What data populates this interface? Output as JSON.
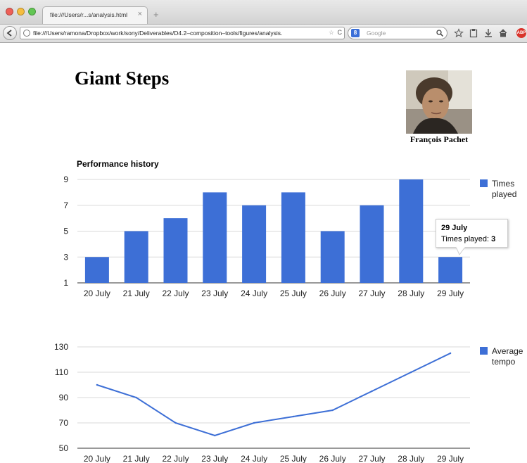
{
  "browser": {
    "tab_title": "file:///Users/r...s/analysis.html",
    "tab_close": "×",
    "new_tab": "+",
    "url": "file:///Users/ramona/Dropbox/work/sony/Deliverables/D4.2–composition–tools/figures/analysis.",
    "url_reload": "C",
    "url_star": "☆",
    "search_engine_letter": "8",
    "search_placeholder": "Google",
    "icons": [
      "search-icon",
      "bookmark-star-icon",
      "clipboard-icon",
      "download-icon",
      "home-icon",
      "adblock-icon"
    ]
  },
  "page": {
    "title": "Giant Steps",
    "author_name": "François Pachet"
  },
  "colors": {
    "series": "#3d6fd6",
    "grid": "#d9d9d9",
    "axis": "#333333"
  },
  "chart_data": [
    {
      "type": "bar",
      "title": "Performance history",
      "categories": [
        "20 July",
        "21 July",
        "22 July",
        "23 July",
        "24 July",
        "25 July",
        "26 July",
        "27 July",
        "28 July",
        "29 July"
      ],
      "series": [
        {
          "name": "Times played",
          "values": [
            3,
            5,
            6,
            8,
            7,
            8,
            5,
            7,
            9,
            3
          ]
        }
      ],
      "y_ticks": [
        "9",
        "7",
        "5",
        "3",
        "1"
      ],
      "ylim": [
        1,
        9
      ],
      "grid": true,
      "legend_position": "right",
      "legend_lines": [
        "Times",
        "played"
      ],
      "tooltip": {
        "title": "29 July",
        "label": "Times played:",
        "value": "3"
      }
    },
    {
      "type": "line",
      "title": "",
      "categories": [
        "20 July",
        "21 July",
        "22 July",
        "23 July",
        "24 July",
        "25 July",
        "26 July",
        "27 July",
        "28 July",
        "29 July"
      ],
      "series": [
        {
          "name": "Average tempo",
          "values": [
            100,
            90,
            70,
            60,
            70,
            75,
            80,
            95,
            110,
            125
          ]
        }
      ],
      "y_ticks": [
        "130",
        "110",
        "90",
        "70",
        "50"
      ],
      "ylim": [
        50,
        130
      ],
      "grid": true,
      "legend_position": "right",
      "legend_lines": [
        "Average",
        "tempo"
      ]
    }
  ]
}
